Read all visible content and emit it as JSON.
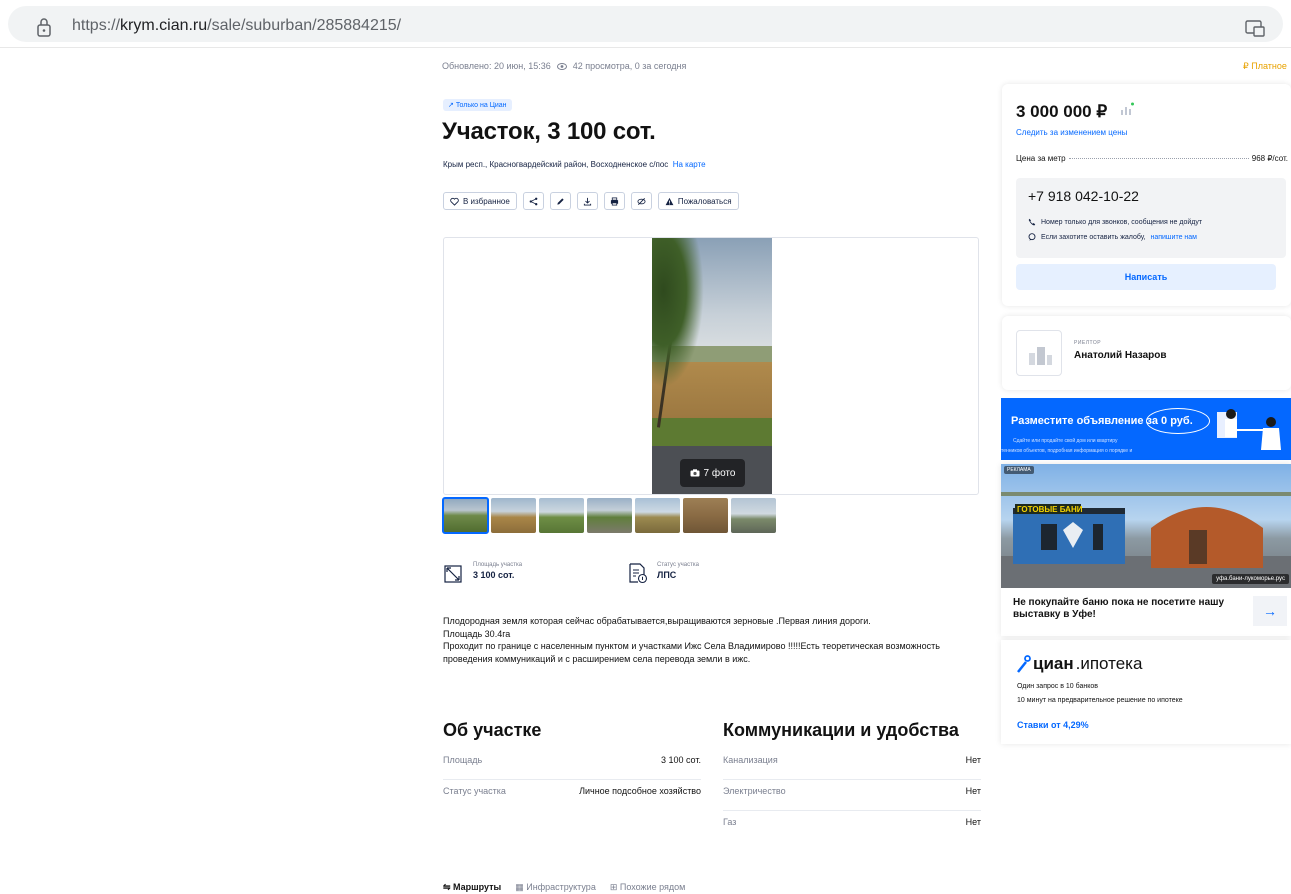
{
  "browser": {
    "url_prefix": "https://",
    "url_domain": "krym.cian.ru",
    "url_path": "/sale/suburban/285884215/"
  },
  "meta": {
    "updated": "Обновлено: 20 июн, 15:36",
    "views": "42 просмотра, 0 за сегодня",
    "paid": "₽ Платное"
  },
  "badge": "Только на Циан",
  "title": "Участок, 3 100 сот.",
  "address": {
    "text": "Крым респ., Красногвардейский район, Восходненское с/пос",
    "map_link": "На карте"
  },
  "actions": {
    "favorite": "В избранное",
    "complain": "Пожаловаться"
  },
  "gallery": {
    "photo_count": "7 фото"
  },
  "specs": [
    {
      "label": "Площадь участка",
      "value": "3 100 сот."
    },
    {
      "label": "Статус участка",
      "value": "ЛПС"
    }
  ],
  "description": [
    "Плодородная земля которая сейчас обрабатывается,выращиваются зерновые .Первая линия дороги.",
    "Площадь 30.4га",
    "Проходит по границе  с населенным пунктом и участками Ижс Села Владимирово !!!!!Есть теоретическая возможность проведения коммуникаций и с расширением села перевода земли в ижс."
  ],
  "about": {
    "title": "Об участке",
    "rows": [
      {
        "k": "Площадь",
        "v": "3 100 сот."
      },
      {
        "k": "Статус участка",
        "v": "Личное подсобное хозяйство"
      }
    ]
  },
  "communications": {
    "title": "Коммуникации и удобства",
    "rows": [
      {
        "k": "Канализация",
        "v": "Нет"
      },
      {
        "k": "Электричество",
        "v": "Нет"
      },
      {
        "k": "Газ",
        "v": "Нет"
      }
    ]
  },
  "bottom_tabs": [
    "Маршруты",
    "Инфраструктура",
    "Похожие рядом"
  ],
  "price_card": {
    "price": "3 000 000 ₽",
    "follow": "Следить за изменением цены",
    "ppm_label": "Цена за метр",
    "ppm_value": "968 ₽/сот.",
    "phone": "+7 918 042-10-22",
    "note1": "Номер только для звонков, сообщения не дойдут",
    "note2_text": "Если захотите оставить жалобу,",
    "note2_link": "напишите нам",
    "write": "Написать"
  },
  "agent": {
    "role": "РИЕЛТОР",
    "name": "Анатолий Назаров"
  },
  "promo": {
    "title_a": "Разместите объявление",
    "title_b": "за 0 руб.",
    "sub1": "Сдайте или продайте свой дом или квартиру",
    "sub2": "тенников объектов, подробная информация о порядке и"
  },
  "ad": {
    "label": "РЕКЛАМА",
    "site": "уфа.бани-лукоморье.рус",
    "sign": "ГОТОВЫЕ БАНИ",
    "headline": "Не покупайте баню пока не посетите нашу выставку в Уфе!",
    "arrow": "→"
  },
  "mortgage": {
    "brand": "циан",
    "product": ".ипотека",
    "line1": "Один запрос в 10 банков",
    "line2": "10 минут на предварительное решение по ипотеке",
    "rate": "Ставки от 4,29%"
  },
  "colors": {
    "accent": "#0468ff",
    "paid": "#e8a200",
    "text": "#121212"
  }
}
